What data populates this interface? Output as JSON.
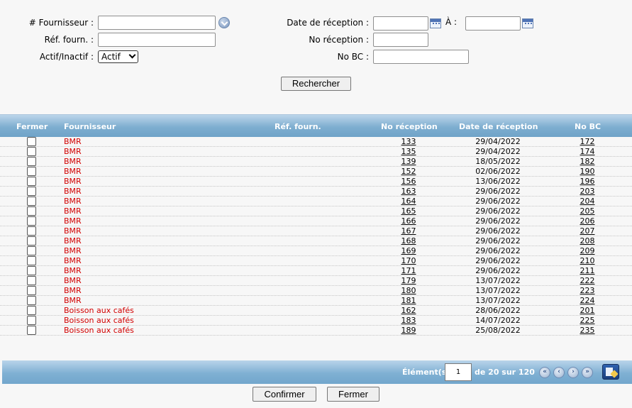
{
  "search": {
    "supplier_label": "# Fournisseur :",
    "supplier_value": "",
    "supplier_ref_label": "Réf. fourn. :",
    "supplier_ref_value": "",
    "active_label": "Actif/Inactif :",
    "active_value": "Actif",
    "reception_date_label": "Date de réception :",
    "reception_date_from": "",
    "to_label": "À :",
    "reception_date_to": "",
    "reception_no_label": "No réception :",
    "reception_no_value": "",
    "po_label": "No BC :",
    "po_value": "",
    "search_button": "Rechercher"
  },
  "table": {
    "headers": {
      "close": "Fermer",
      "supplier": "Fournisseur",
      "supplier_ref": "Réf. fourn.",
      "reception_no": "No réception",
      "reception_date": "Date de réception",
      "po_no": "No BC"
    },
    "rows": [
      {
        "supplier": "BMR",
        "ref": "",
        "reception": "133",
        "date": "29/04/2022",
        "po": "172"
      },
      {
        "supplier": "BMR",
        "ref": "",
        "reception": "135",
        "date": "29/04/2022",
        "po": "174"
      },
      {
        "supplier": "BMR",
        "ref": "",
        "reception": "139",
        "date": "18/05/2022",
        "po": "182"
      },
      {
        "supplier": "BMR",
        "ref": "",
        "reception": "152",
        "date": "02/06/2022",
        "po": "190"
      },
      {
        "supplier": "BMR",
        "ref": "",
        "reception": "156",
        "date": "13/06/2022",
        "po": "196"
      },
      {
        "supplier": "BMR",
        "ref": "",
        "reception": "163",
        "date": "29/06/2022",
        "po": "203"
      },
      {
        "supplier": "BMR",
        "ref": "",
        "reception": "164",
        "date": "29/06/2022",
        "po": "204"
      },
      {
        "supplier": "BMR",
        "ref": "",
        "reception": "165",
        "date": "29/06/2022",
        "po": "205"
      },
      {
        "supplier": "BMR",
        "ref": "",
        "reception": "166",
        "date": "29/06/2022",
        "po": "206"
      },
      {
        "supplier": "BMR",
        "ref": "",
        "reception": "167",
        "date": "29/06/2022",
        "po": "207"
      },
      {
        "supplier": "BMR",
        "ref": "",
        "reception": "168",
        "date": "29/06/2022",
        "po": "208"
      },
      {
        "supplier": "BMR",
        "ref": "",
        "reception": "169",
        "date": "29/06/2022",
        "po": "209"
      },
      {
        "supplier": "BMR",
        "ref": "",
        "reception": "170",
        "date": "29/06/2022",
        "po": "210"
      },
      {
        "supplier": "BMR",
        "ref": "",
        "reception": "171",
        "date": "29/06/2022",
        "po": "211"
      },
      {
        "supplier": "BMR",
        "ref": "",
        "reception": "179",
        "date": "13/07/2022",
        "po": "222"
      },
      {
        "supplier": "BMR",
        "ref": "",
        "reception": "180",
        "date": "13/07/2022",
        "po": "223"
      },
      {
        "supplier": "BMR",
        "ref": "",
        "reception": "181",
        "date": "13/07/2022",
        "po": "224"
      },
      {
        "supplier": "Boisson aux cafés",
        "ref": "",
        "reception": "162",
        "date": "28/06/2022",
        "po": "201"
      },
      {
        "supplier": "Boisson aux cafés",
        "ref": "",
        "reception": "183",
        "date": "14/07/2022",
        "po": "225"
      },
      {
        "supplier": "Boisson aux cafés",
        "ref": "",
        "reception": "189",
        "date": "25/08/2022",
        "po": "235"
      }
    ]
  },
  "pager": {
    "items_label": "Élément(s)",
    "current_page": "1",
    "range_text": "de 20 sur 120",
    "first": "«",
    "prev": "‹",
    "next": "›",
    "last": "»",
    "export_icon": "export-icon"
  },
  "footer": {
    "confirm_button": "Confirmer",
    "close_button": "Fermer"
  }
}
